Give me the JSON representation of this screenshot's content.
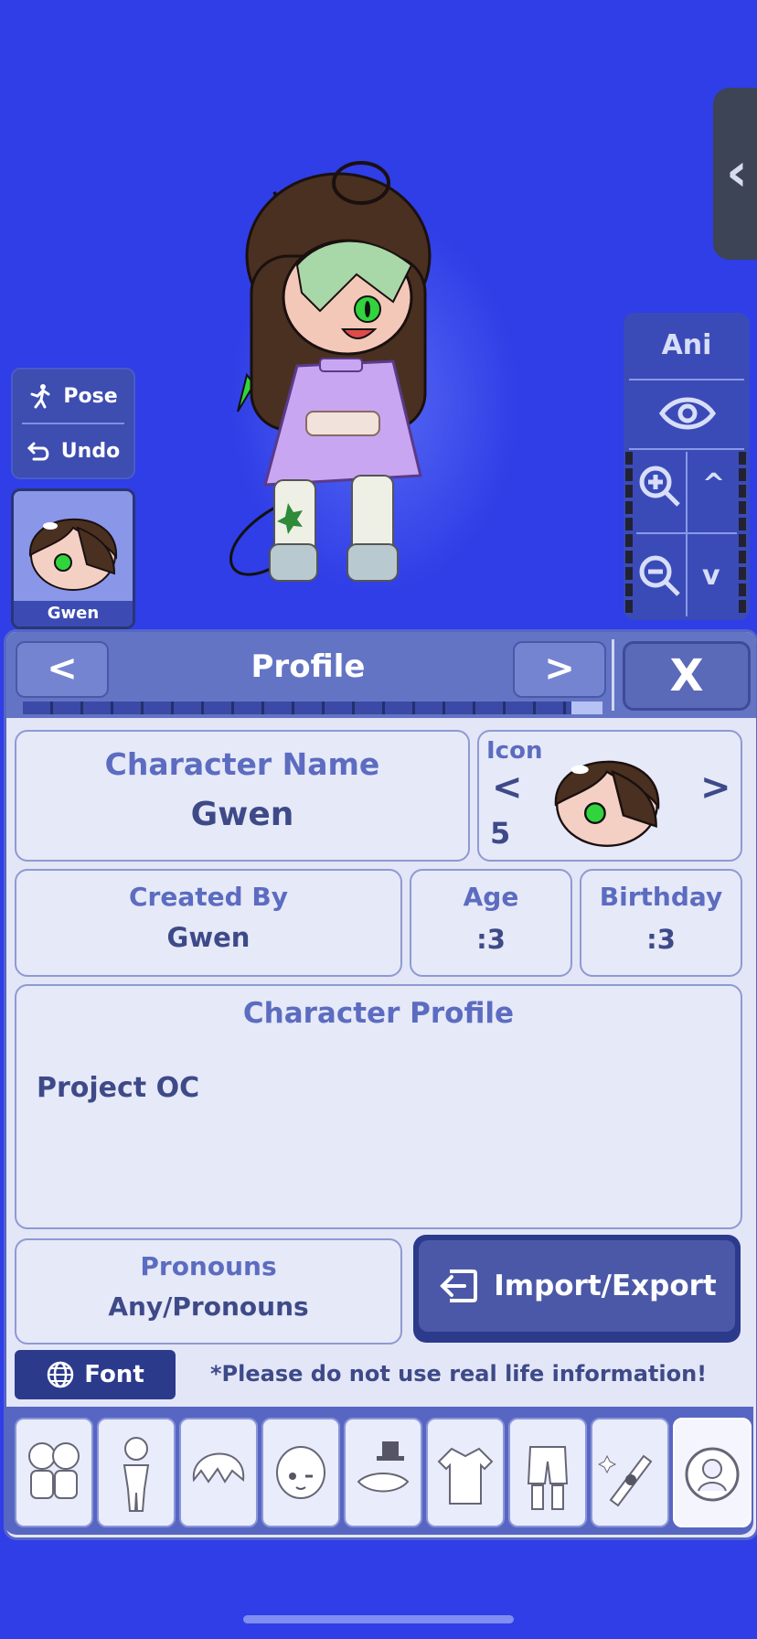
{
  "left_panel": {
    "pose_label": "Pose",
    "undo_label": "Undo"
  },
  "avatar_card": {
    "name": "Gwen"
  },
  "ani_panel": {
    "label": "Ani"
  },
  "sheet": {
    "title": "Profile",
    "prev_label": "<",
    "next_label": ">",
    "close_label": "X",
    "character_name": {
      "label": "Character Name",
      "value": "Gwen"
    },
    "icon": {
      "label": "Icon",
      "prev": "<",
      "next": ">",
      "number": "5"
    },
    "created_by": {
      "label": "Created By",
      "value": "Gwen"
    },
    "age": {
      "label": "Age",
      "value": ":3"
    },
    "birthday": {
      "label": "Birthday",
      "value": ":3"
    },
    "character_profile": {
      "label": "Character Profile",
      "value": "Project OC"
    },
    "pronouns": {
      "label": "Pronouns",
      "value": "Any/Pronouns"
    },
    "import_export_label": "Import/Export",
    "font_label": "Font",
    "notice": "*Please do not use real life information!"
  },
  "tabs": [
    {
      "icon": "characters-icon"
    },
    {
      "icon": "body-icon"
    },
    {
      "icon": "hair-icon"
    },
    {
      "icon": "face-icon"
    },
    {
      "icon": "accessories-icon"
    },
    {
      "icon": "top-icon"
    },
    {
      "icon": "bottom-icon"
    },
    {
      "icon": "props-icon"
    },
    {
      "icon": "profile-icon",
      "selected": true
    }
  ],
  "colors": {
    "background": "#2f3ee6",
    "panel": "#e3e6f7",
    "accent": "#6474c4",
    "dark_button": "#2c3a8c"
  }
}
